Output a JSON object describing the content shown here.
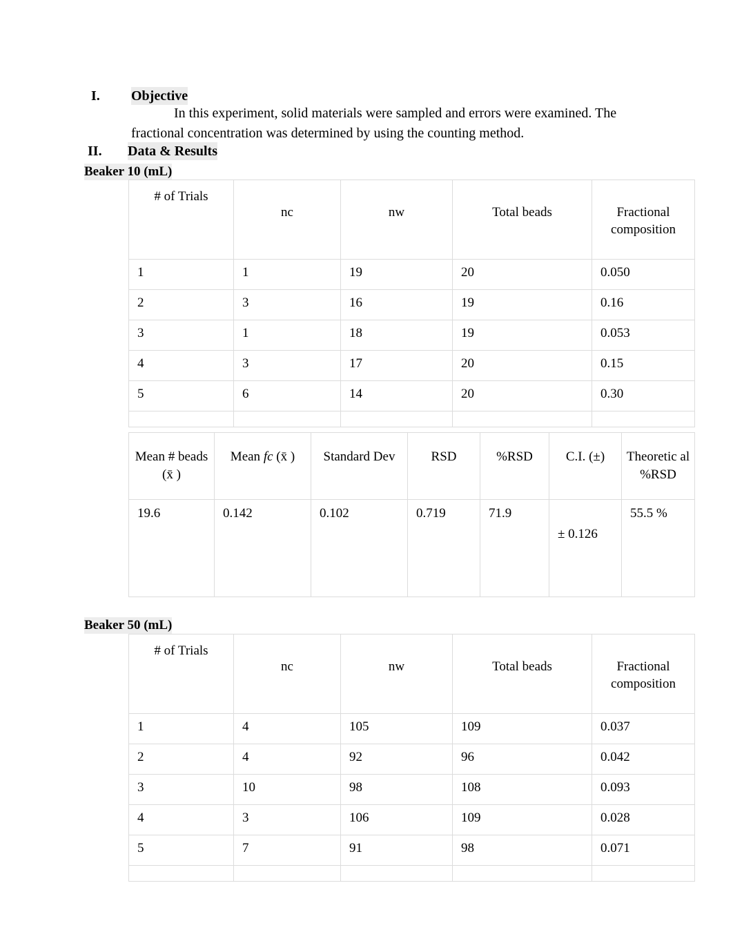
{
  "document": {
    "sections": [
      {
        "numeral": "I.",
        "title": "Objective"
      },
      {
        "numeral": "II.",
        "title": "Data & Results"
      }
    ],
    "objective_paragraph": "In this experiment, solid materials were sampled and errors were examined. The fractional concentration was determined by using the counting method."
  },
  "beaker10": {
    "heading": "Beaker 10 (mL)",
    "trials_table": {
      "headers": [
        "# of Trials",
        "nc",
        "nw",
        "Total beads",
        "Fractional composition"
      ],
      "rows": [
        {
          "trial": "1",
          "nc": "1",
          "nw": "19",
          "total": "20",
          "fc": "0.050"
        },
        {
          "trial": "2",
          "nc": "3",
          "nw": "16",
          "total": "19",
          "fc": "0.16"
        },
        {
          "trial": "3",
          "nc": "1",
          "nw": "18",
          "total": "19",
          "fc": "0.053"
        },
        {
          "trial": "4",
          "nc": "3",
          "nw": "17",
          "total": "20",
          "fc": "0.15"
        },
        {
          "trial": "5",
          "nc": "6",
          "nw": "14",
          "total": "20",
          "fc": "0.30"
        }
      ]
    },
    "stats_table": {
      "headers": {
        "mean_beads": "Mean # beads (x̄ )",
        "mean_fc_pre": "Mean ",
        "mean_fc_ital": "fc",
        "mean_fc_post": " (x̄ )",
        "std_dev": "Standard Dev",
        "rsd": "RSD",
        "pct_rsd": "%RSD",
        "ci": "C.I. (±)",
        "theoretical_rsd": "Theoretic al %RSD"
      },
      "values": {
        "mean_beads": "19.6",
        "mean_fc": "0.142",
        "std_dev": "0.102",
        "rsd": "0.719",
        "pct_rsd": "71.9",
        "ci": "± 0.126",
        "theoretical_rsd": "55.5 %"
      }
    }
  },
  "beaker50": {
    "heading": "Beaker 50 (mL)",
    "trials_table": {
      "headers": [
        "# of Trials",
        "nc",
        "nw",
        "Total beads",
        "Fractional composition"
      ],
      "rows": [
        {
          "trial": "1",
          "nc": "4",
          "nw": "105",
          "total": "109",
          "fc": "0.037"
        },
        {
          "trial": "2",
          "nc": "4",
          "nw": "92",
          "total": "96",
          "fc": "0.042"
        },
        {
          "trial": "3",
          "nc": "10",
          "nw": "98",
          "total": "108",
          "fc": "0.093"
        },
        {
          "trial": "4",
          "nc": "3",
          "nw": "106",
          "total": "109",
          "fc": "0.028"
        },
        {
          "trial": "5",
          "nc": "7",
          "nw": "91",
          "total": "98",
          "fc": "0.071"
        }
      ]
    }
  }
}
